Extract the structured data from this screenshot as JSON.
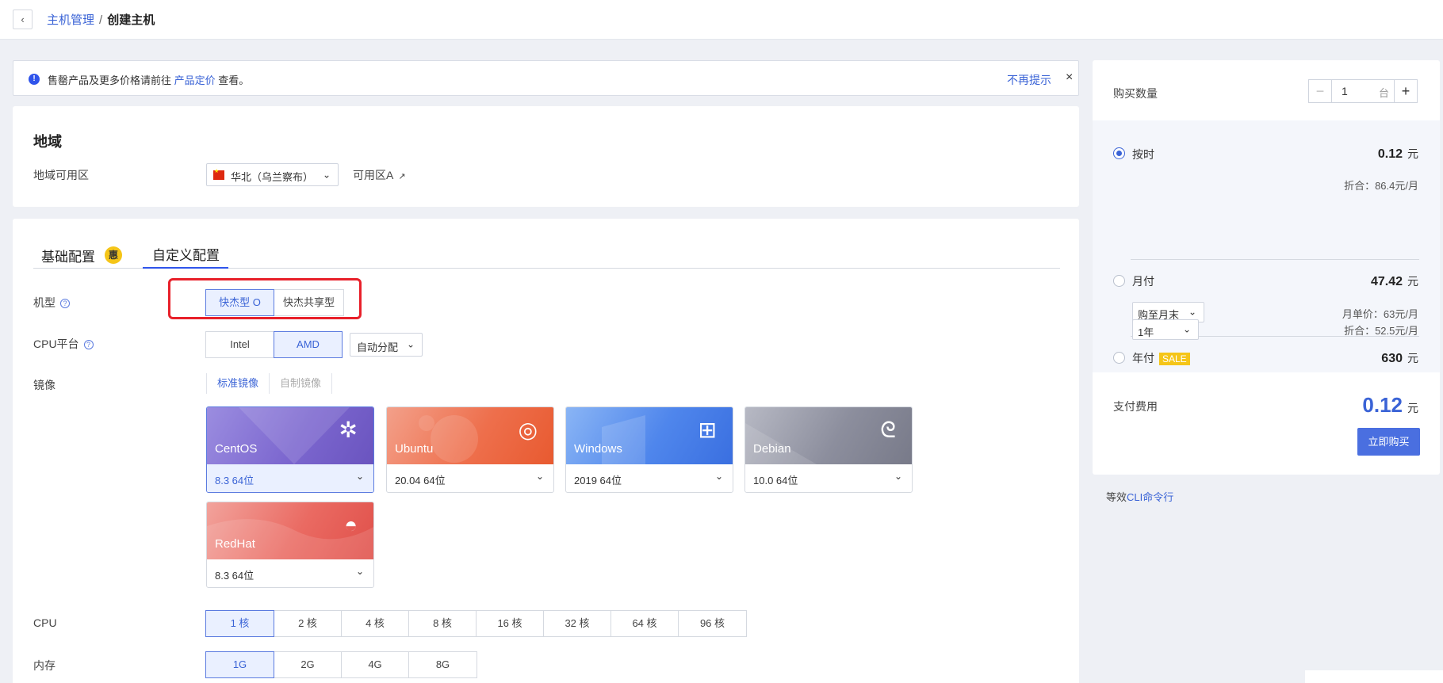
{
  "breadcrumb": {
    "parent": "主机管理",
    "separator": "/",
    "current": "创建主机"
  },
  "notice": {
    "text_prefix": "售罄产品及更多价格请前往",
    "link": "产品定价",
    "text_suffix": "查看。",
    "dismiss": "不再提示",
    "close": "×"
  },
  "region": {
    "title": "地域",
    "label": "地域可用区",
    "value": "华北（乌兰察布）",
    "zone": "可用区A"
  },
  "tabs": [
    {
      "label": "基础配置",
      "badge": "惠"
    },
    {
      "label": "自定义配置"
    }
  ],
  "machine_type": {
    "label": "机型",
    "options": [
      "快杰型 O",
      "快杰共享型"
    ],
    "selected": "快杰型 O"
  },
  "cpu_platform": {
    "label": "CPU平台",
    "options": [
      "Intel",
      "AMD"
    ],
    "selected": "AMD",
    "dropdown": "自动分配"
  },
  "image": {
    "label": "镜像",
    "tabs": [
      "标准镜像",
      "自制镜像"
    ],
    "os": [
      {
        "name": "CentOS",
        "version": "8.3 64位",
        "selected": true,
        "logo": "✲"
      },
      {
        "name": "Ubuntu",
        "version": "20.04 64位",
        "selected": false,
        "logo": "◎"
      },
      {
        "name": "Windows",
        "version": "2019 64位",
        "selected": false,
        "logo": "⊞"
      },
      {
        "name": "Debian",
        "version": "10.0 64位",
        "selected": false,
        "logo": "ᘓ"
      },
      {
        "name": "RedHat",
        "version": "8.3 64位",
        "selected": false,
        "logo": "◓"
      }
    ]
  },
  "cpu": {
    "label": "CPU",
    "options": [
      "1 核",
      "2 核",
      "4 核",
      "8 核",
      "16 核",
      "32 核",
      "64 核",
      "96 核"
    ],
    "selected": "1 核"
  },
  "memory": {
    "label": "内存",
    "options": [
      "1G",
      "2G",
      "4G",
      "8G"
    ],
    "selected": "1G"
  },
  "order": {
    "qty_label": "购买数量",
    "qty_value": "1",
    "qty_unit": "台",
    "minus": "−",
    "plus": "+",
    "plans": [
      {
        "name": "按时",
        "price": "0.12",
        "unit": "元",
        "note": "折合：86.4元/月",
        "selected": true
      },
      {
        "name": "月付",
        "price": "47.42",
        "unit": "元",
        "option": "购至月末",
        "note": "月单价：63元/月",
        "selected": false
      },
      {
        "name": "年付",
        "sale": "SALE",
        "price": "630",
        "unit": "元",
        "option": "1年",
        "note": "折合：52.5元/月",
        "selected": false
      }
    ],
    "total_label": "支付费用",
    "total_price": "0.12",
    "total_unit": "元",
    "buy": "立即购买",
    "cli_prefix": "等效",
    "cli_link": "CLI命令行"
  },
  "colors": {
    "accent": "#3a63d6",
    "highlight": "#e8202a",
    "sale": "#f5c518"
  }
}
